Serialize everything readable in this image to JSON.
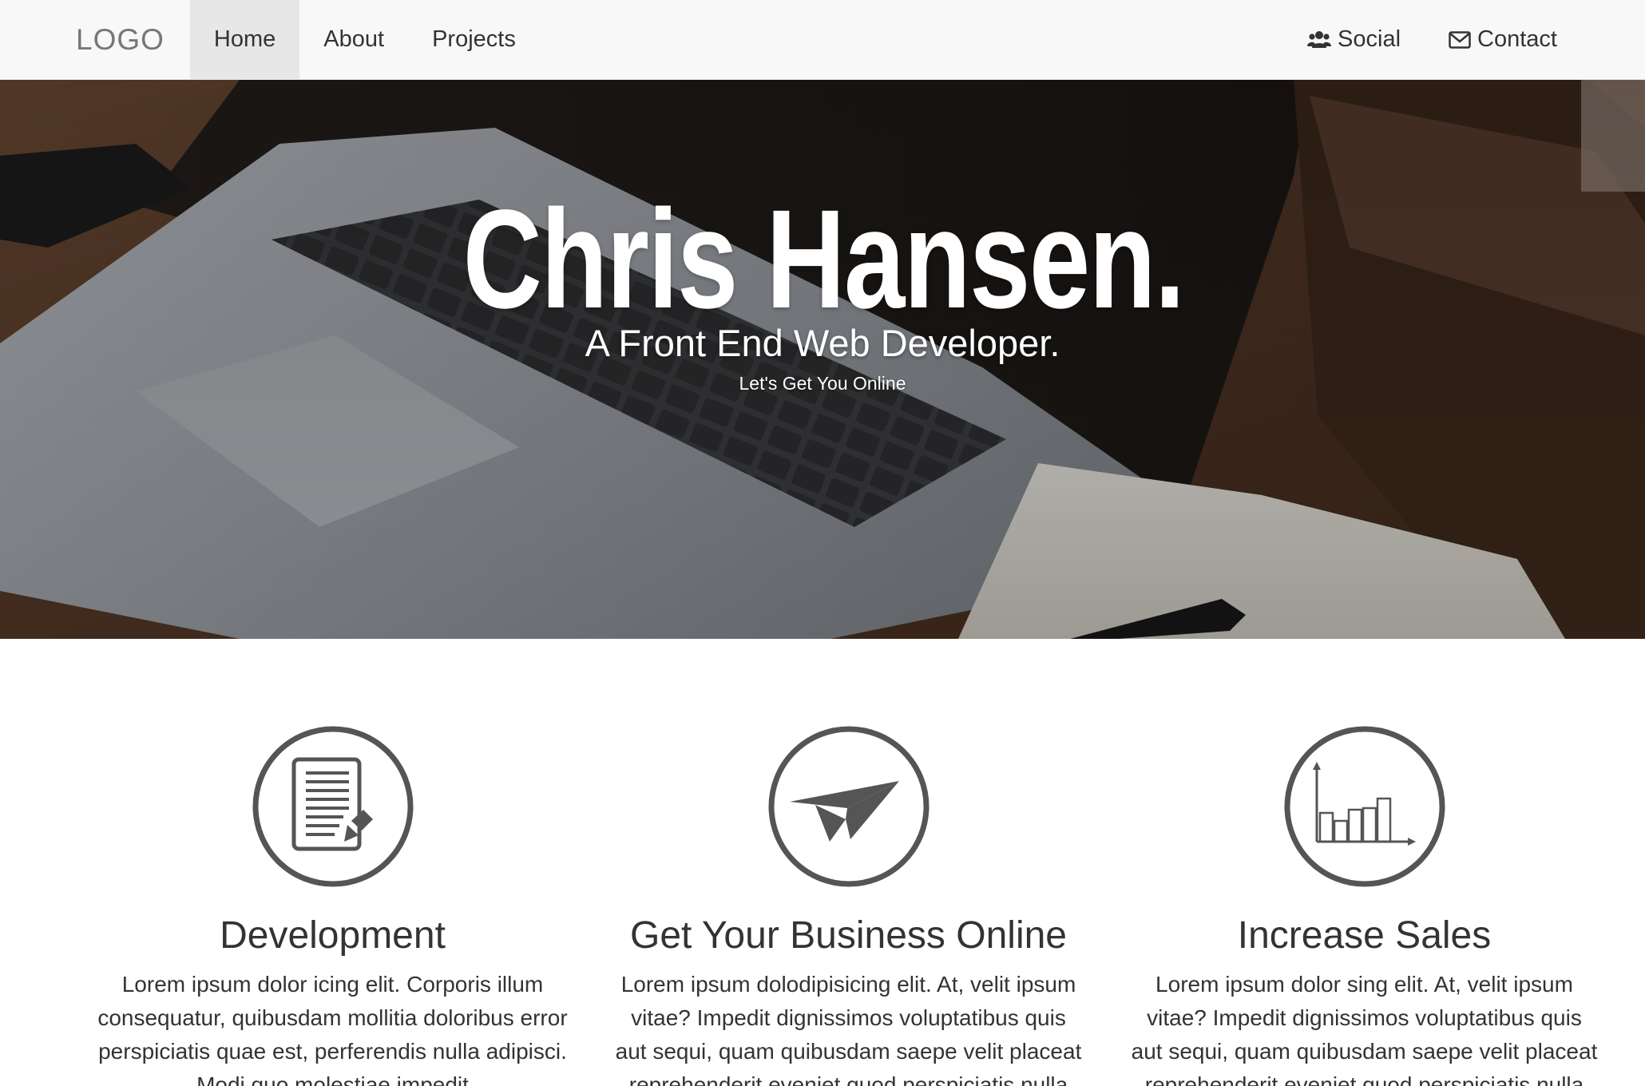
{
  "navbar": {
    "brand": "LOGO",
    "left_items": [
      {
        "label": "Home"
      },
      {
        "label": "About"
      },
      {
        "label": "Projects"
      }
    ],
    "right_items": [
      {
        "label": "Social",
        "icon": "users-icon"
      },
      {
        "label": "Contact",
        "icon": "envelope-icon"
      }
    ]
  },
  "hero": {
    "title": "Chris Hansen.",
    "subtitle": "A Front End Web Developer.",
    "tagline": "Let's Get You Online"
  },
  "features": [
    {
      "icon": "document-edit-icon",
      "title": "Development",
      "text": "Lorem ipsum dolor icing elit. Corporis illum consequatur, quibusdam mollitia doloribus error perspiciatis quae est, perferendis nulla adipisci. Modi quo molestiae impedit"
    },
    {
      "icon": "paper-plane-icon",
      "title": "Get Your Business Online",
      "text": "Lorem ipsum dolodipisicing elit. At, velit ipsum vitae? Impedit dignissimos voluptatibus quis aut sequi, quam quibusdam saepe velit placeat reprehenderit eveniet quod perspiciatis nulla"
    },
    {
      "icon": "bar-chart-icon",
      "title": "Increase Sales",
      "text": "Lorem ipsum dolor sing elit. At, velit ipsum vitae? Impedit dignissimos voluptatibus quis aut sequi, quam quibusdam saepe velit placeat reprehenderit eveniet quod perspiciatis nulla"
    }
  ],
  "colors": {
    "navbar_bg": "#f8f8f8",
    "nav_active_bg": "#e7e7e7",
    "icon_stroke": "#555555",
    "text": "#333333"
  }
}
